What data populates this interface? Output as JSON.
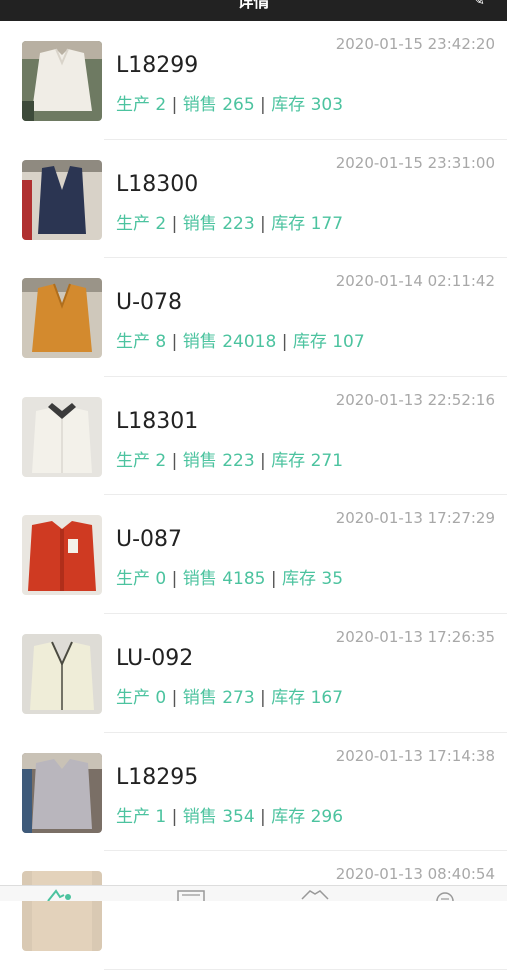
{
  "header": {
    "title": "详情",
    "edit_icon": "edit-icon"
  },
  "colors": {
    "accent": "#4cc39f",
    "header_bg": "#222222",
    "timestamp": "#a8a8a8"
  },
  "labels": {
    "production": "生产",
    "sales": "销售",
    "stock": "库存",
    "separator": "|"
  },
  "items": [
    {
      "code": "L18299",
      "timestamp": "2020-01-15 23:42:20",
      "production": "2",
      "sales": "265",
      "stock": "303"
    },
    {
      "code": "L18300",
      "timestamp": "2020-01-15 23:31:00",
      "production": "2",
      "sales": "223",
      "stock": "177"
    },
    {
      "code": "U-078",
      "timestamp": "2020-01-14 02:11:42",
      "production": "8",
      "sales": "24018",
      "stock": "107"
    },
    {
      "code": "L18301",
      "timestamp": "2020-01-13 22:52:16",
      "production": "2",
      "sales": "223",
      "stock": "271"
    },
    {
      "code": "U-087",
      "timestamp": "2020-01-13 17:27:29",
      "production": "0",
      "sales": "4185",
      "stock": "35"
    },
    {
      "code": "LU-092",
      "timestamp": "2020-01-13 17:26:35",
      "production": "0",
      "sales": "273",
      "stock": "167"
    },
    {
      "code": "L18295",
      "timestamp": "2020-01-13 17:14:38",
      "production": "1",
      "sales": "354",
      "stock": "296"
    },
    {
      "code": "",
      "timestamp": "2020-01-13 08:40:54",
      "production": "",
      "sales": "",
      "stock": ""
    }
  ],
  "tabbar": {
    "tabs": [
      "home-tab-icon",
      "orders-tab-icon",
      "clothing-tab-icon",
      "profile-tab-icon"
    ]
  }
}
